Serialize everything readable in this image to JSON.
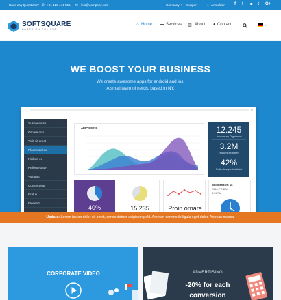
{
  "topbar": {
    "question": "Have any Questions?",
    "phone": "+01 123 444 555",
    "email": "info@company.com",
    "company": "Company",
    "support": "Support",
    "login": "Anmelden"
  },
  "brand": {
    "name": "SOFTSQUARE",
    "tagline": "BASED ON ECLIPSE"
  },
  "nav": {
    "home": "Home",
    "services": "Services",
    "about": "About",
    "contact": "Contact"
  },
  "hero": {
    "title": "WE BOOST YOUR BUSINESS",
    "line1": "We create awesome apps for android and ios.",
    "line2": "A small team of nerds, based in NY."
  },
  "dashboard": {
    "sidebar": [
      "Suspendisse",
      "Ornare orci",
      "Velit sit amet",
      "Placerat arcu",
      "Finibus eu",
      "Pellentesque",
      "Volutpat",
      "Consectetur",
      "Erat eu",
      "Eleifend"
    ],
    "active_index": 3,
    "chart_title": "ADIPISCING",
    "stats": [
      {
        "value": "12.245",
        "label": "Accumsan Dignissim"
      },
      {
        "value": "3.2M",
        "label": "Mauris sit amet"
      },
      {
        "value": "42%",
        "label": "Pellentesque habitant"
      }
    ],
    "pie_pct": "40%",
    "pie_value": "15.235",
    "line_label": "Proin ornare",
    "calendar": {
      "date": "DECEMBER 16",
      "day": "2016, FRIDAY",
      "time": "4:09 PM"
    }
  },
  "banner": {
    "label": "Update:",
    "text": "Lorem ipsum dolor sit amet, consectetuer adipiscing elit. Aenean commodo ligula eget dolor. Aenean massa."
  },
  "promo_left": {
    "title": "CORPORATE VIDEO"
  },
  "promo_right": {
    "kicker": "ADVERTISING",
    "line1": "-20% for each",
    "line2": "conversion"
  },
  "colors": {
    "brand_blue": "#1e88cf",
    "dark_navy": "#20496c",
    "banner_orange": "#e57722",
    "purple": "#5e3e91"
  },
  "icons": [
    "phone-icon",
    "mail-icon",
    "user-icon",
    "facebook-icon",
    "twitter-icon",
    "paper-plane-icon",
    "tumblr-icon",
    "googleplus-icon",
    "home-icon",
    "car-icon",
    "bar-chart-icon",
    "user-icon",
    "search-icon",
    "flag-de-icon",
    "play-icon"
  ]
}
